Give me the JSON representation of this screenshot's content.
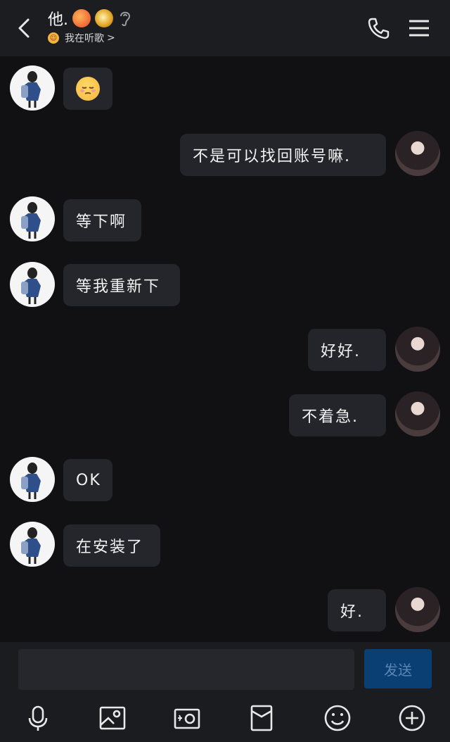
{
  "header": {
    "title": "他.",
    "status_text": "我在听歌",
    "status_chevron": ">",
    "badges": [
      "fire-badge-icon",
      "gold-medal-icon",
      "ear-icon"
    ]
  },
  "messages": [
    {
      "side": "left",
      "text": "😔"
    },
    {
      "side": "right",
      "text": "不是可以找回账号嘛."
    },
    {
      "side": "left",
      "text": "等下啊"
    },
    {
      "side": "left",
      "text": "等我重新下"
    },
    {
      "side": "right",
      "text": "好好."
    },
    {
      "side": "right",
      "text": "不着急."
    },
    {
      "side": "left",
      "text": "OK"
    },
    {
      "side": "left",
      "text": "在安装了"
    },
    {
      "side": "right",
      "text": "好."
    }
  ],
  "composer": {
    "input_value": "",
    "send_label": "发送"
  },
  "toolbar": {
    "items": [
      "microphone-icon",
      "image-icon",
      "camera-icon",
      "gift-envelope-icon",
      "emoji-icon",
      "add-icon"
    ]
  },
  "colors": {
    "background": "#111113",
    "header": "#1c1d21",
    "bubble": "#25262b",
    "send_button": "#0a3f74",
    "send_text": "#5a86b4"
  }
}
